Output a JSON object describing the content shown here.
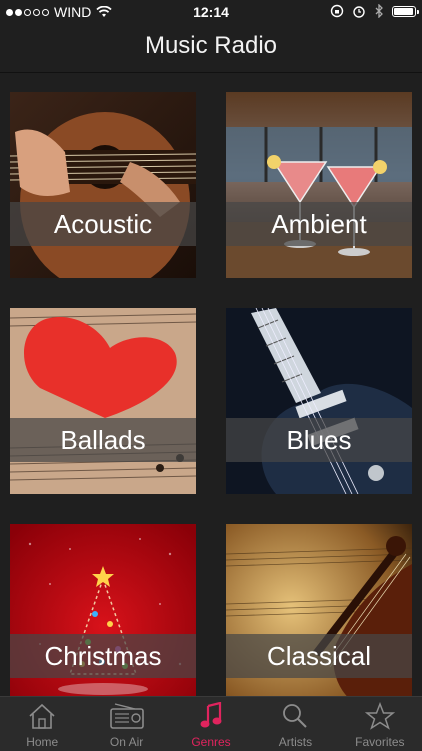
{
  "status_bar": {
    "carrier": "WIND",
    "time": "12:14",
    "signal_bars_filled": 2,
    "signal_bars_total": 5
  },
  "header": {
    "title": "Music Radio"
  },
  "genres": [
    {
      "label": "Acoustic",
      "icon": "acoustic-guitar-image"
    },
    {
      "label": "Ambient",
      "icon": "cocktails-image"
    },
    {
      "label": "Ballads",
      "icon": "heart-sheet-music-image"
    },
    {
      "label": "Blues",
      "icon": "electric-guitar-image"
    },
    {
      "label": "Christmas",
      "icon": "christmas-tree-image"
    },
    {
      "label": "Classical",
      "icon": "violin-sheet-music-image"
    }
  ],
  "tabbar": {
    "active_color": "#e0245e",
    "items": [
      {
        "label": "Home",
        "icon": "home-icon"
      },
      {
        "label": "On Air",
        "icon": "radio-icon"
      },
      {
        "label": "Genres",
        "icon": "music-note-icon",
        "active": true
      },
      {
        "label": "Artists",
        "icon": "search-icon"
      },
      {
        "label": "Favorites",
        "icon": "star-icon"
      }
    ]
  }
}
